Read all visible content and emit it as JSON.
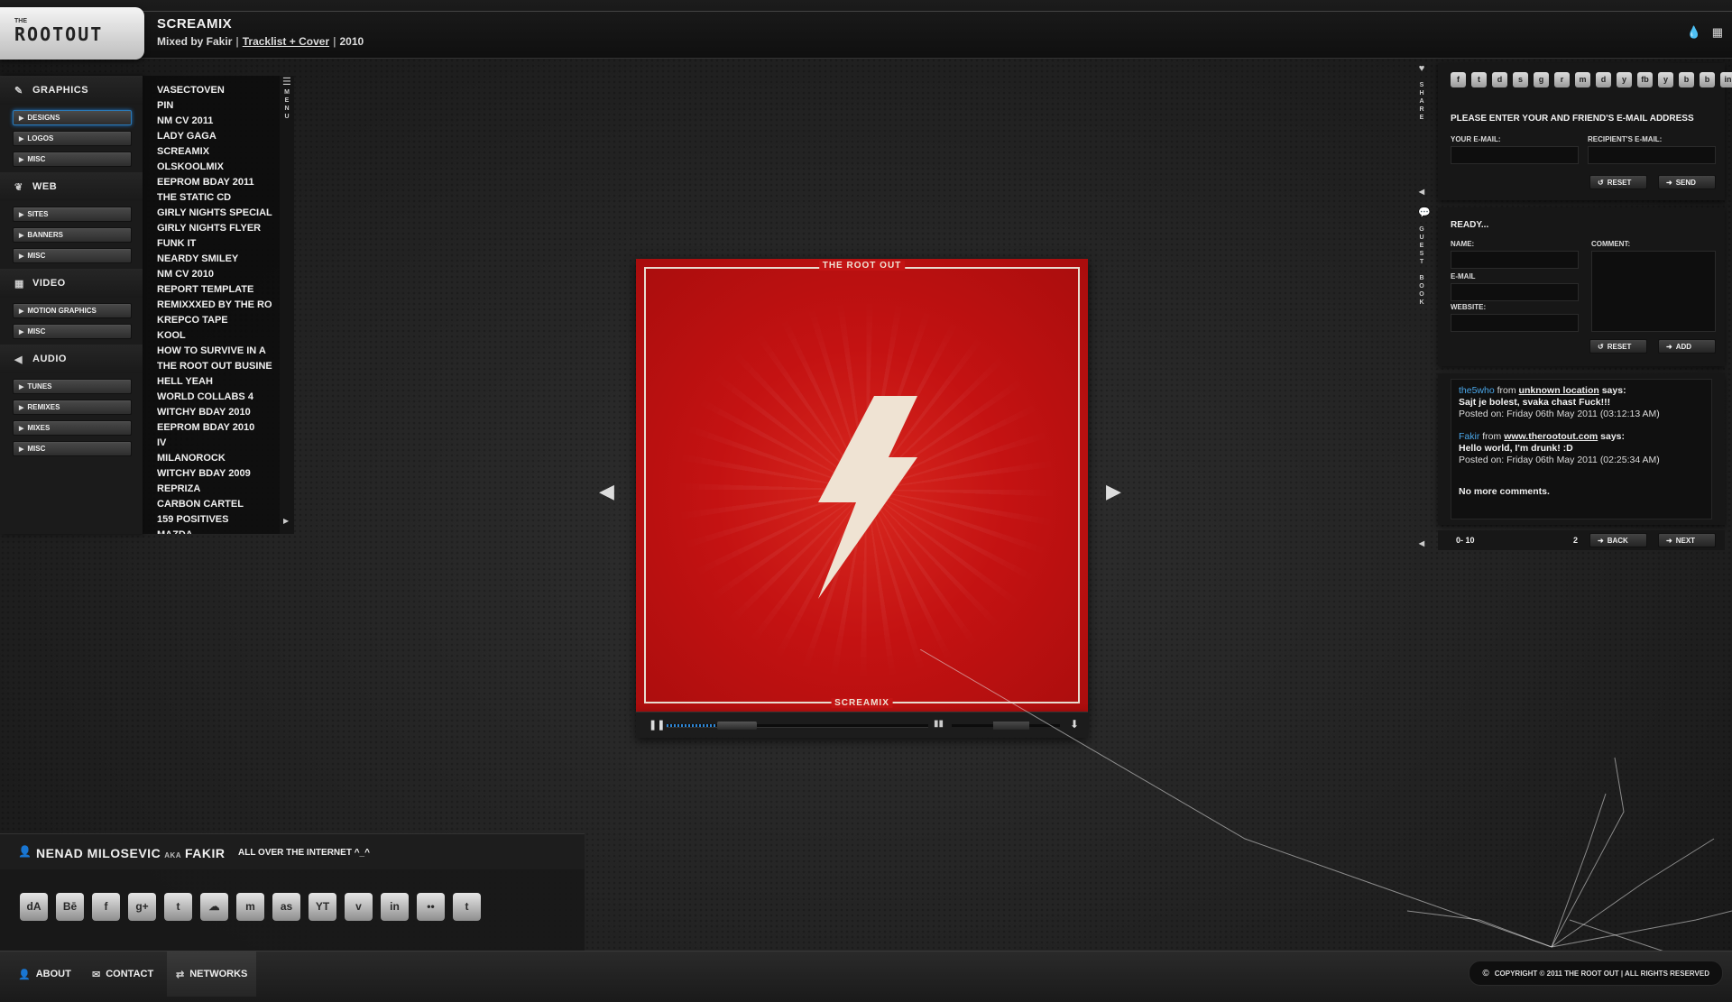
{
  "header": {
    "logo_small": "THE",
    "logo_text": "ROOTOUT",
    "title": "SCREAMIX",
    "mixed_by": "Mixed by Fakir",
    "tracklist_link": "Tracklist + Cover",
    "year": "2010",
    "separator": "|"
  },
  "categories": [
    {
      "label": "GRAPHICS",
      "icon": "pencil-icon",
      "subs": [
        "DESIGNS",
        "LOGOS",
        "MISC"
      ]
    },
    {
      "label": "WEB",
      "icon": "leaf-icon",
      "subs": [
        "SITES",
        "BANNERS",
        "MISC"
      ]
    },
    {
      "label": "VIDEO",
      "icon": "film-icon",
      "subs": [
        "MOTION GRAPHICS",
        "MISC"
      ]
    },
    {
      "label": "AUDIO",
      "icon": "speaker-icon",
      "subs": [
        "TUNES",
        "REMIXES",
        "MIXES",
        "MISC"
      ]
    }
  ],
  "list_items": [
    "VASECTOVEN",
    "PIN",
    "NM CV 2011",
    "LADY GAGA",
    "SCREAMIX",
    "OLSKOOLMIX",
    "EEPROM BDAY 2011",
    "THE STATIC CD",
    "GIRLY NIGHTS SPECIAL",
    "GIRLY NIGHTS FLYER",
    "FUNK IT",
    "NEARDY SMILEY",
    "NM CV 2010",
    "REPORT TEMPLATE",
    "REMIXXXED BY THE RO",
    "KREPCO TAPE",
    "KOOL",
    "HOW TO SURVIVE IN A",
    "THE ROOT OUT BUSINE",
    "HELL YEAH",
    "WORLD COLLABS 4",
    "WITCHY BDAY 2010",
    "EEPROM BDAY 2010",
    "IV",
    "MILANOROCK",
    "WITCHY BDAY 2009",
    "REPRIZA",
    "CARBON CARTEL",
    "159 POSITIVES",
    "MAZDA"
  ],
  "menu_label": "MENU",
  "artwork": {
    "top_label": "THE ROOT OUT",
    "bottom_label": "SCREAMIX",
    "bg_color": "#c41212"
  },
  "player": {
    "progress": 0.27,
    "volume": 0.55,
    "accent": "#2e86d4"
  },
  "side_labels": {
    "share": "SHARE",
    "guestbook": "GUEST BOOK"
  },
  "share": {
    "title": "PLEASE ENTER YOUR AND FRIEND'S E-MAIL ADDRESS",
    "your_email_label": "YOUR E-MAIL:",
    "recipient_label": "RECIPIENT'S E-MAIL:",
    "reset": "RESET",
    "send": "SEND",
    "social": [
      "f",
      "t",
      "d",
      "s",
      "g",
      "r",
      "m",
      "d",
      "y",
      "fb",
      "y",
      "b",
      "b",
      "in"
    ]
  },
  "guestbook": {
    "status": "READY...",
    "name_label": "NAME:",
    "email_label": "E-MAIL",
    "website_label": "WEBSITE:",
    "comment_label": "COMMENT:",
    "reset": "RESET",
    "add": "ADD"
  },
  "comments": [
    {
      "who": "the5who",
      "from": "from",
      "location": "unknown location",
      "says": "says:",
      "message": "Sajt je bolest, svaka chast Fuck!!!",
      "posted": "Posted on: Friday 06th May 2011 (03:12:13 AM)"
    },
    {
      "who": "Fakir",
      "from": "from",
      "location": "www.therootout.com",
      "says": "says:",
      "message": "Hello world, I'm drunk! :D",
      "posted": "Posted on: Friday 06th May 2011 (02:25:34 AM)"
    }
  ],
  "no_more": "No more comments.",
  "pager": {
    "range": "0- 10",
    "total": "2",
    "back": "BACK",
    "next": "NEXT"
  },
  "profile": {
    "first": "NENAD MILOSEVIC",
    "aka": "AKA",
    "nick": "FAKIR",
    "tagline": "ALL OVER THE INTERNET ^_^"
  },
  "networks": [
    {
      "name": "deviantart",
      "glyph": "dA"
    },
    {
      "name": "behance",
      "glyph": "Bē"
    },
    {
      "name": "facebook",
      "glyph": "f"
    },
    {
      "name": "google",
      "glyph": "g+"
    },
    {
      "name": "twitter",
      "glyph": "t"
    },
    {
      "name": "soundcloud",
      "glyph": "☁"
    },
    {
      "name": "myspace",
      "glyph": "m"
    },
    {
      "name": "lastfm",
      "glyph": "as"
    },
    {
      "name": "youtube",
      "glyph": "YT"
    },
    {
      "name": "vimeo",
      "glyph": "v"
    },
    {
      "name": "linkedin",
      "glyph": "in"
    },
    {
      "name": "flickr",
      "glyph": "••"
    },
    {
      "name": "tumblr",
      "glyph": "t"
    }
  ],
  "footer": {
    "about": "ABOUT",
    "contact": "CONTACT",
    "networks": "NETWORKS",
    "copyright": "COPYRIGHT © 2011 THE ROOT OUT | ALL RIGHTS RESERVED"
  }
}
